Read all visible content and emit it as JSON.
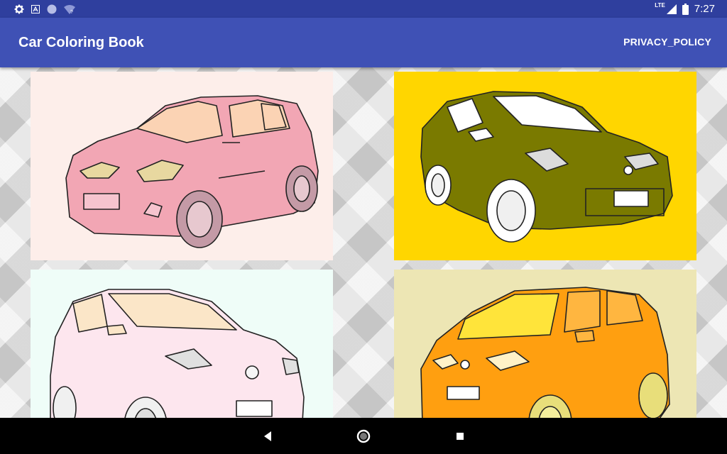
{
  "status_bar": {
    "time": "7:27",
    "network": "LTE",
    "icons": [
      "settings-icon",
      "a-badge-icon",
      "circle-icon",
      "wifi-question-icon",
      "lte-signal-icon",
      "battery-icon"
    ]
  },
  "app_bar": {
    "title": "Car Coloring Book",
    "privacy_label": "PRIVACY_POLICY"
  },
  "colors": {
    "app_bar": "#3f51b5",
    "status_bar": "#2f3f9e",
    "tile1_bg": "#fdeeea",
    "tile1_body": "#f2a6b4",
    "tile2_bg": "#ffd600",
    "tile2_body": "#7a7a00",
    "tile3_bg": "#effdf8",
    "tile3_body": "#fde6ee",
    "tile4_bg": "#ede6b4",
    "tile4_body": "#ff9f10"
  },
  "tiles": [
    {
      "name": "pink-hatchback"
    },
    {
      "name": "olive-hatchback"
    },
    {
      "name": "light-pink-hatchback"
    },
    {
      "name": "orange-minivan"
    }
  ],
  "nav_bar": {
    "icons": [
      "back-icon",
      "home-icon",
      "recents-icon"
    ]
  }
}
